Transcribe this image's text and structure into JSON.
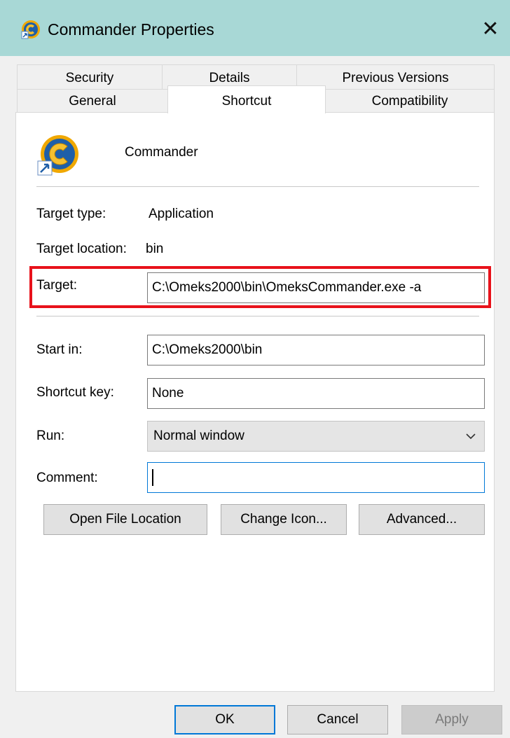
{
  "window": {
    "title": "Commander Properties",
    "close_glyph": "✕",
    "icon": "commander-app-icon"
  },
  "tabs": {
    "row1": [
      {
        "label": "Security"
      },
      {
        "label": "Details"
      },
      {
        "label": "Previous Versions"
      }
    ],
    "row2": [
      {
        "label": "General"
      },
      {
        "label": "Shortcut",
        "active": true
      },
      {
        "label": "Compatibility"
      }
    ]
  },
  "shortcut": {
    "name": "Commander",
    "icon": "commander-shortcut-icon",
    "target_type_label": "Target type:",
    "target_type_value": "Application",
    "target_location_label": "Target location:",
    "target_location_value": "bin",
    "target_label": "Target:",
    "target_value": "C:\\Omeks2000\\bin\\OmeksCommander.exe -a",
    "start_in_label": "Start in:",
    "start_in_value": "C:\\Omeks2000\\bin",
    "shortcut_key_label": "Shortcut key:",
    "shortcut_key_value": "None",
    "run_label": "Run:",
    "run_value": "Normal window",
    "comment_label": "Comment:",
    "comment_value": ""
  },
  "actions": {
    "open_file_location": "Open File Location",
    "change_icon": "Change Icon...",
    "advanced": "Advanced..."
  },
  "footer": {
    "ok": "OK",
    "cancel": "Cancel",
    "apply": "Apply"
  },
  "colors": {
    "titlebar": "#a8d8d6",
    "highlight": "#e8121b",
    "focus": "#0078d7"
  }
}
